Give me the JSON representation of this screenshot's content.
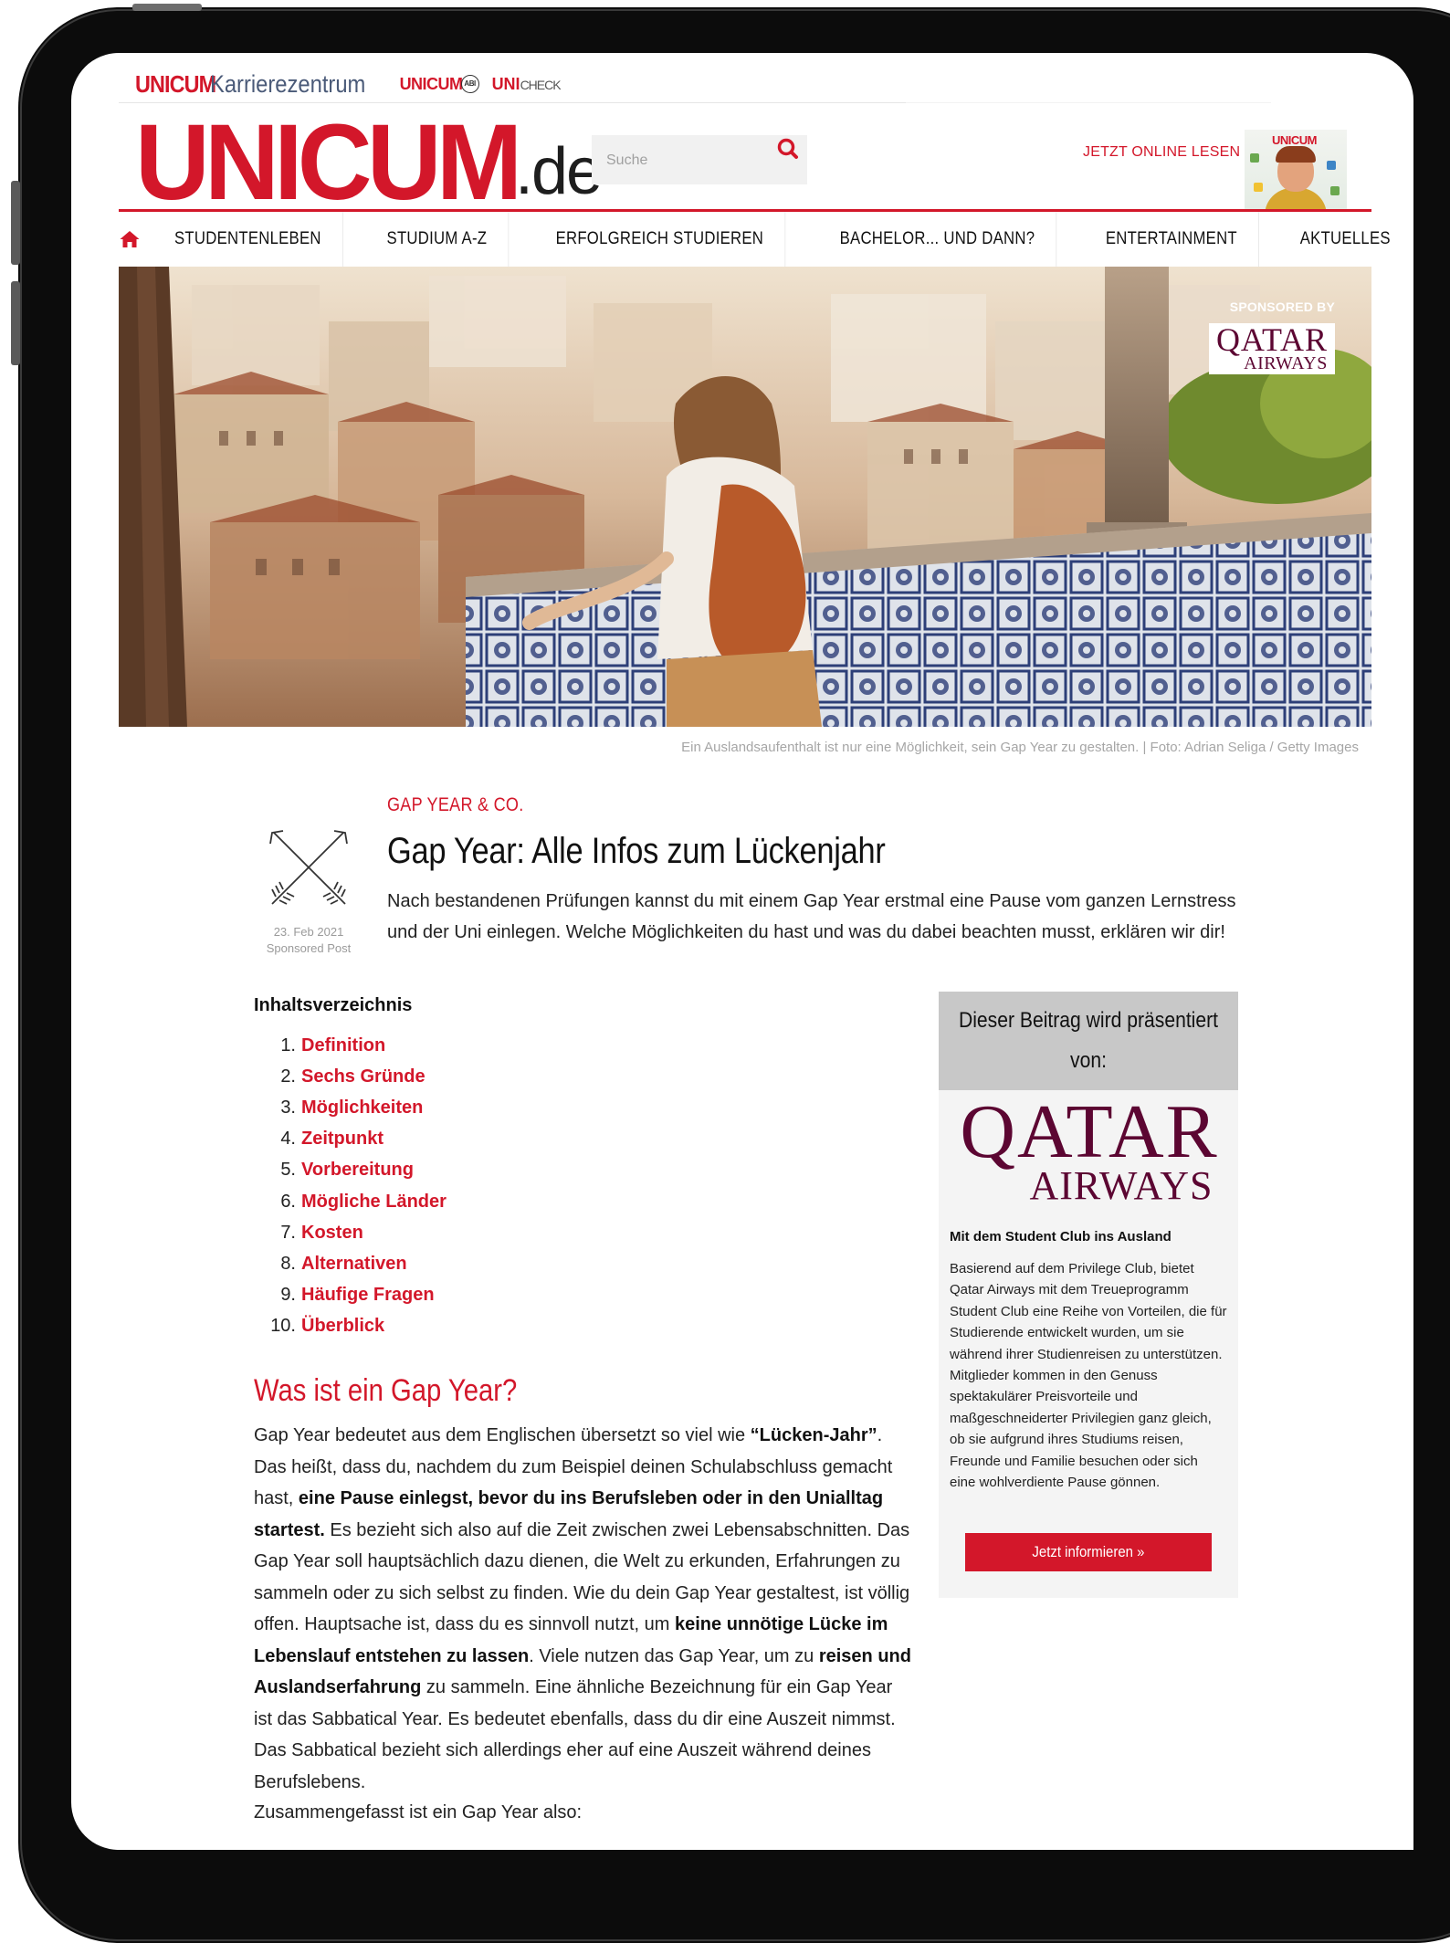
{
  "brandbar": {
    "unicum": "UNICUM",
    "karriere": "Karrierezentrum",
    "abi": "UNICUM",
    "abi_badge": "ABI",
    "unicheck_u": "UNI",
    "unicheck_c": "CHECK"
  },
  "header": {
    "logo_main": "UNICUM",
    "logo_tld": ".de",
    "search_placeholder": "Suche",
    "online_label": "JETZT ONLINE LESEN",
    "magazine_title": "UNICUM"
  },
  "nav": {
    "items": [
      "STUDENTENLEBEN",
      "STUDIUM A-Z",
      "ERFOLGREICH STUDIEREN",
      "BACHELOR... UND DANN?",
      "ENTERTAINMENT",
      "AKTUELLES"
    ]
  },
  "hero": {
    "sponsored_label": "SPONSORED BY",
    "sponsor_line1": "QATAR",
    "sponsor_line2": "AIRWAYS",
    "caption": "Ein Auslandsaufenthalt ist nur eine Möglichkeit, sein Gap Year zu gestalten. | Foto: Adrian Seliga / Getty Images"
  },
  "article": {
    "date": "23. Feb 2021",
    "post_type": "Sponsored Post",
    "kicker": "GAP YEAR & CO.",
    "title": "Gap Year: Alle Infos zum Lückenjahr",
    "lead": "Nach bestandenen Prüfungen kannst du mit einem Gap Year erstmal eine Pause vom ganzen Lernstress und der Uni einlegen. Welche Möglichkeiten du hast und was du dabei beachten musst, erklären wir dir!"
  },
  "toc": {
    "title": "Inhaltsverzeichnis",
    "items": [
      {
        "num": "1.",
        "label": "Definition"
      },
      {
        "num": "2.",
        "label": "Sechs Gründe"
      },
      {
        "num": "3.",
        "label": "Möglichkeiten"
      },
      {
        "num": "4.",
        "label": "Zeitpunkt"
      },
      {
        "num": "5.",
        "label": "Vorbereitung"
      },
      {
        "num": "6.",
        "label": "Mögliche Länder"
      },
      {
        "num": "7.",
        "label": "Kosten"
      },
      {
        "num": "8.",
        "label": "Alternativen"
      },
      {
        "num": "9.",
        "label": "Häufige Fragen"
      },
      {
        "num": "10.",
        "label": "Überblick"
      }
    ]
  },
  "section": {
    "heading": "Was ist ein Gap Year?",
    "p1": [
      "Gap Year bedeutet aus dem Englischen übersetzt so viel wie ",
      "“Lücken-Jahr”",
      ". Das heißt, dass du, nachdem du zum Beispiel deinen Schulabschluss gemacht hast, ",
      "eine Pause einlegst, bevor du ins Berufsleben oder in den Unialltag startest.",
      " Es bezieht sich also auf die Zeit zwischen zwei Lebensabschnitten. Das Gap Year soll hauptsächlich dazu dienen, die Welt zu erkunden, Erfahrungen zu sammeln oder zu sich selbst zu finden. Wie du dein Gap Year gestaltest, ist völlig offen. Hauptsache ist, dass du es sinnvoll nutzt, um ",
      "keine unnötige Lücke im Lebenslauf entstehen zu lassen",
      ". Viele nutzen das Gap Year, um zu ",
      "reisen und Auslandserfahrung",
      " zu sammeln. Eine ähnliche Bezeichnung für ein Gap Year ist das Sabbatical Year. Es bedeutet ebenfalls, dass du dir eine Auszeit nimmst. Das Sabbatical bezieht sich allerdings eher auf eine Auszeit während deines Berufslebens."
    ],
    "p2": "Zusammengefasst ist ein Gap Year also:"
  },
  "sidebar": {
    "heading": "Dieser Beitrag wird präsentiert von:",
    "logo_line1": "QATAR",
    "logo_line2": "AIRWAYS",
    "subheading": "Mit dem Student Club ins Ausland",
    "text": "Basierend auf dem Privilege Club, bietet Qatar Airways mit dem Treueprogramm Student Club eine Reihe von Vorteilen, die für Studierende entwickelt wurden, um sie während ihrer Studienreisen zu unterstützen. Mitglieder kommen in den Genuss spektakulärer Preisvorteile und maßgeschneiderter Privilegien ganz gleich, ob sie aufgrund ihres Studiums reisen, Freunde und Familie besuchen oder sich eine wohlverdiente Pause gönnen.",
    "button": "Jetzt informieren »"
  },
  "colors": {
    "accent": "#d3172a",
    "qatar": "#5c0632",
    "sidebar_head": "#c8c8c8"
  }
}
